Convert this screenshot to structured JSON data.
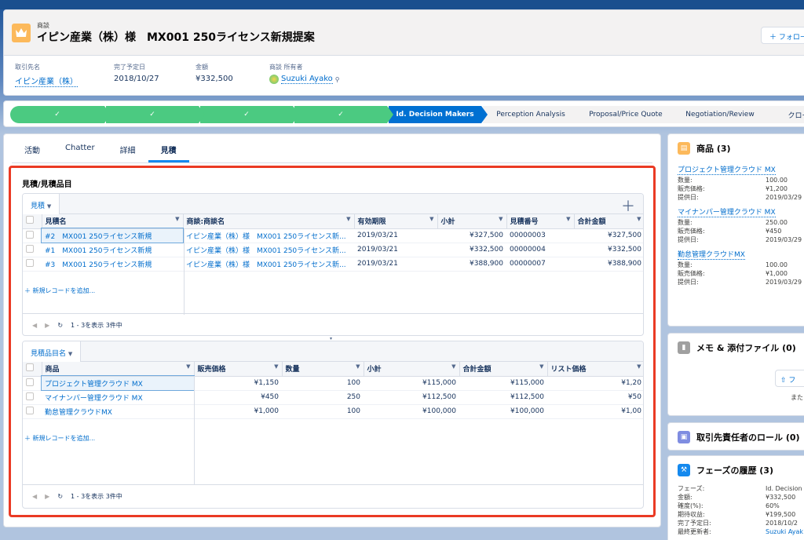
{
  "header": {
    "subtitle": "商談",
    "title": "イピン産業（株）様　MX001 250ライセンス新規提案",
    "follow_label": "＋ フォロー",
    "fields": [
      {
        "label": "取引先名",
        "value": "イピン産業（株）",
        "link": true
      },
      {
        "label": "完了予定日",
        "value": "2018/10/27",
        "link": false
      },
      {
        "label": "金額",
        "value": "¥332,500",
        "link": false
      },
      {
        "label": "商談 所有者",
        "value": "Suzuki Ayako",
        "link": true
      }
    ]
  },
  "path": {
    "stages": [
      {
        "label": "✓",
        "status": "done"
      },
      {
        "label": "✓",
        "status": "done"
      },
      {
        "label": "✓",
        "status": "done"
      },
      {
        "label": "✓",
        "status": "done"
      },
      {
        "label": "Id. Decision Makers",
        "status": "current"
      },
      {
        "label": "Perception Analysis",
        "status": "todo"
      },
      {
        "label": "Proposal/Price Quote",
        "status": "todo"
      },
      {
        "label": "Negotiation/Review",
        "status": "todo"
      },
      {
        "label": "クロー",
        "status": "todo"
      }
    ]
  },
  "tabs": [
    "活動",
    "Chatter",
    "詳細",
    "見積"
  ],
  "section_title": "見積/見積品目",
  "quotes": {
    "view_label": "見積",
    "columns": [
      "見積名",
      "商談:商談名",
      "有効期限",
      "小計",
      "見積番号",
      "合計金額"
    ],
    "rows": [
      {
        "name": "#2　MX001 250ライセンス新規",
        "opp": "イピン産業（株）様　MX001 250ライセンス新...",
        "expiry": "2019/03/21",
        "subtotal": "¥327,500",
        "number": "00000003",
        "total": "¥327,500"
      },
      {
        "name": "#1　MX001 250ライセンス新規",
        "opp": "イピン産業（株）様　MX001 250ライセンス新...",
        "expiry": "2019/03/21",
        "subtotal": "¥332,500",
        "number": "00000004",
        "total": "¥332,500"
      },
      {
        "name": "#3　MX001 250ライセンス新規",
        "opp": "イピン産業（株）様　MX001 250ライセンス新...",
        "expiry": "2019/03/21",
        "subtotal": "¥388,900",
        "number": "00000007",
        "total": "¥388,900"
      }
    ],
    "add_label": "＋ 新規レコードを追加...",
    "pager_label": "1 - 3を表示 3件中"
  },
  "lines": {
    "view_label": "見積品目名",
    "columns": [
      "商品",
      "販売価格",
      "数量",
      "小計",
      "合計金額",
      "リスト価格"
    ],
    "rows": [
      {
        "product": "プロジェクト管理クラウド MX",
        "price": "¥1,150",
        "qty": "100",
        "subtotal": "¥115,000",
        "total": "¥115,000",
        "list": "¥1,20"
      },
      {
        "product": "マイナンパー管理クラウド MX",
        "price": "¥450",
        "qty": "250",
        "subtotal": "¥112,500",
        "total": "¥112,500",
        "list": "¥50"
      },
      {
        "product": "勤怠管理クラウドMX",
        "price": "¥1,000",
        "qty": "100",
        "subtotal": "¥100,000",
        "total": "¥100,000",
        "list": "¥1,00"
      }
    ],
    "add_label": "＋ 新規レコードを追加...",
    "pager_label": "1 - 3を表示 3件中"
  },
  "products_card": {
    "title": "商品 (3)",
    "items": [
      {
        "name": "プロジェクト管理クラウド MX",
        "qty": "100.00",
        "price": "¥1,200",
        "date": "2019/03/29"
      },
      {
        "name": "マイナンパー管理クラウド MX",
        "qty": "250.00",
        "price": "¥450",
        "date": "2019/03/29"
      },
      {
        "name": "勤怠管理クラウドMX",
        "qty": "100.00",
        "price": "¥1,000",
        "date": "2019/03/29"
      }
    ],
    "labels": {
      "qty": "数量:",
      "price": "販売価格:",
      "date": "提供日:"
    }
  },
  "notes_card": {
    "title": "メモ & 添付ファイル (0)",
    "upload_label": "⇧ フ",
    "or_label": "また"
  },
  "roles_card": {
    "title": "取引先責任者のロール (0)"
  },
  "history_card": {
    "title": "フェーズの履歴 (3)",
    "rows": [
      {
        "k": "フェーズ:",
        "v": "Id. Decision"
      },
      {
        "k": "金額:",
        "v": "¥332,500"
      },
      {
        "k": "確度(%):",
        "v": "60%"
      },
      {
        "k": "期待収益:",
        "v": "¥199,500"
      },
      {
        "k": "完了予定日:",
        "v": "2018/10/2"
      },
      {
        "k": "最終更新者:",
        "v": "Suzuki Ayak"
      }
    ]
  }
}
